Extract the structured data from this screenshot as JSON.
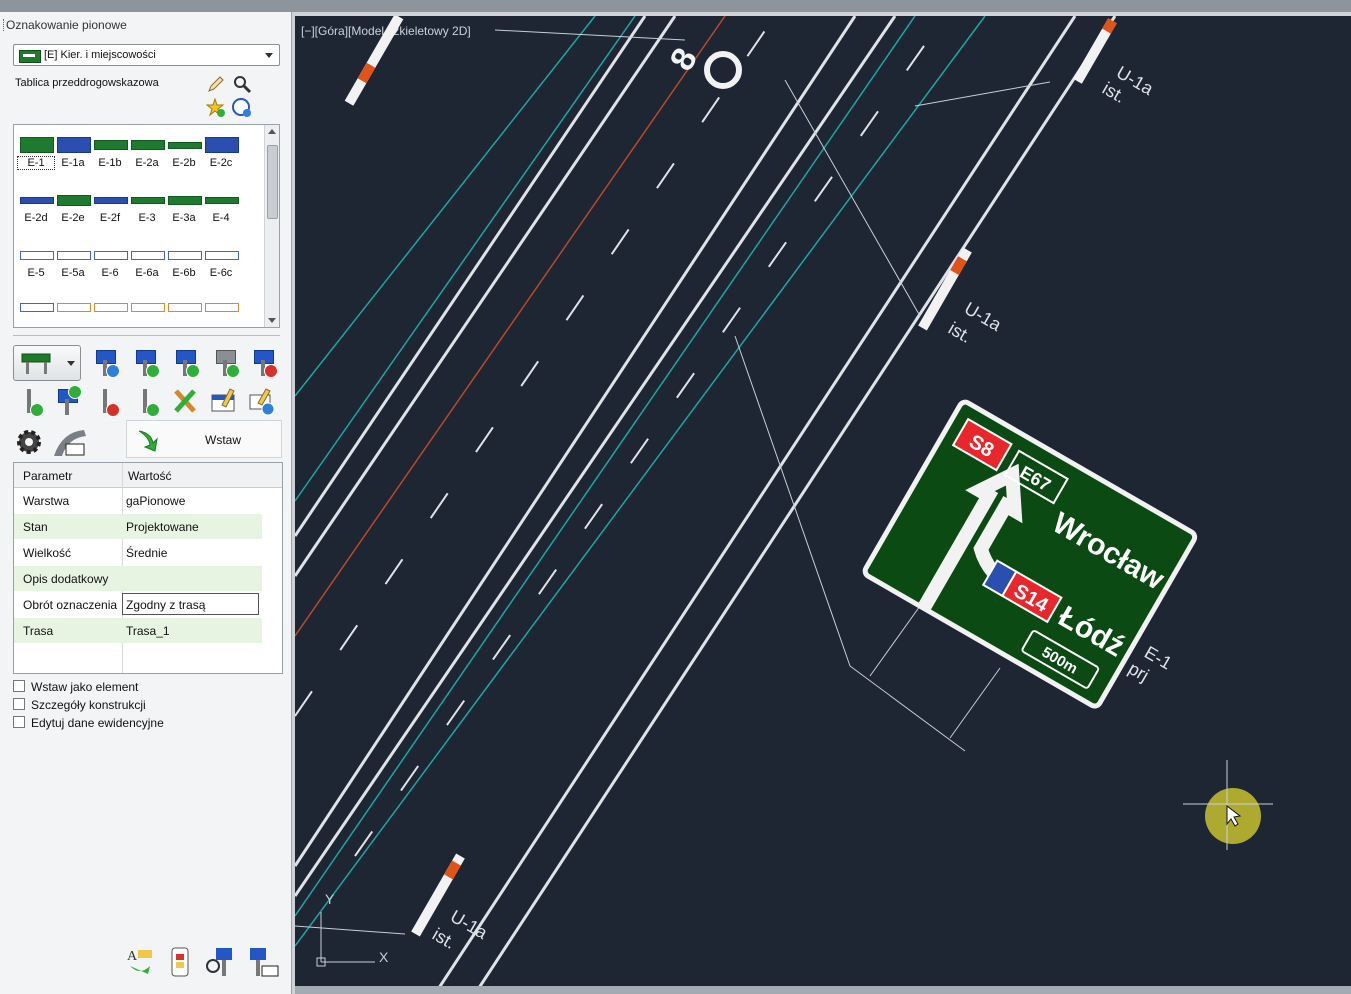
{
  "panel": {
    "title": "Oznakowanie pionowe",
    "category": "[E] Kier. i miejscowości",
    "subtitle": "Tablica przeddrogowskazowa",
    "signs": [
      "E-1",
      "E-1a",
      "E-1b",
      "E-2a",
      "E-2b",
      "E-2c",
      "E-2d",
      "E-2e",
      "E-2f",
      "E-3",
      "E-3a",
      "E-4",
      "E-5",
      "E-5a",
      "E-6",
      "E-6a",
      "E-6b",
      "E-6c"
    ],
    "insert_label": "Wstaw",
    "table": {
      "col_param": "Parametr",
      "col_value": "Wartość",
      "rows": [
        {
          "k": "Warstwa",
          "v": "gaPionowe"
        },
        {
          "k": "Stan",
          "v": "Projektowane"
        },
        {
          "k": "Wielkość",
          "v": "Średnie"
        },
        {
          "k": "Opis dodatkowy",
          "v": ""
        },
        {
          "k": "Obrót oznaczenia",
          "v": "Zgodny z trasą"
        },
        {
          "k": "Trasa",
          "v": "Trasa_1"
        }
      ]
    },
    "checkboxes": [
      "Wstaw jako element",
      "Szczegóły konstrukcji",
      "Edytuj dane ewidencyjne"
    ]
  },
  "viewport": {
    "label": "[−][Góra][Model szkieletowy 2D]",
    "sign": {
      "badge1": "S8",
      "badge2": "E67",
      "badge3": "S14",
      "dest1": "Wrocław",
      "dest2": "Łódź",
      "distance": "500m"
    },
    "annotations": {
      "u1a": "U-1a",
      "ist": "ist.",
      "e1": "E-1",
      "prj": "prj",
      "road_no": "8"
    },
    "ucs": {
      "x": "X",
      "y": "Y"
    }
  },
  "colors": {
    "canvas_bg": "#1e2533",
    "sign_green": "#0b4a12",
    "badge_red": "#e8262b",
    "lane_cyan": "#1aa7a7",
    "axis_red": "#b84a2a"
  }
}
